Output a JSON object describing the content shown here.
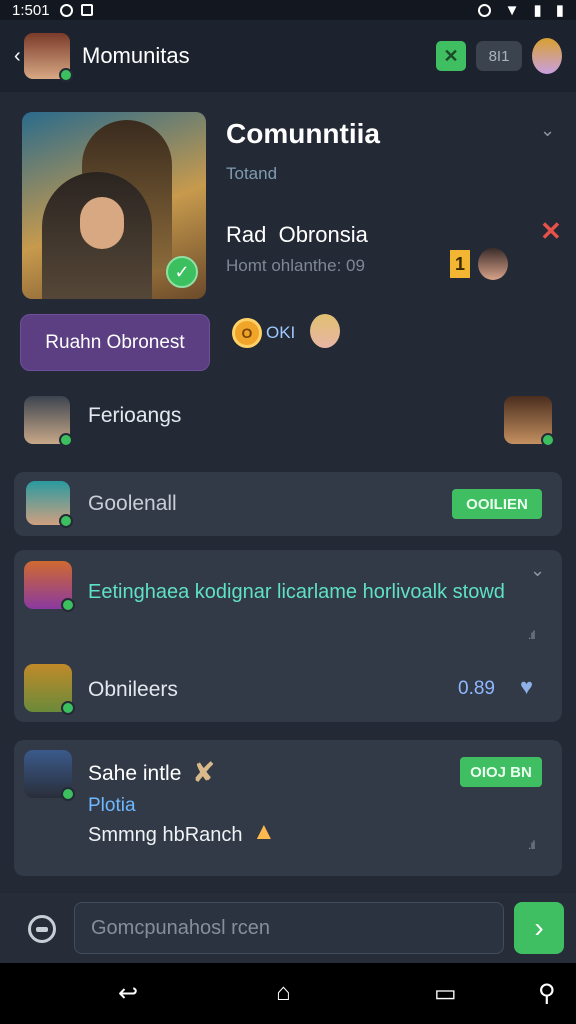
{
  "status_bar": {
    "time": "1:501"
  },
  "header": {
    "title": "Momunitas",
    "count": "8I1",
    "back_icon": "chevron-left-icon"
  },
  "featured": {
    "title": "Comunntiia",
    "subtitle": "Totand",
    "name": "Rad  Obronsia",
    "meta": "Homt ohlanthe: 09",
    "rank": "1",
    "join_label": "Ruahn Obronest",
    "coin_label": "OKI",
    "coin_symbol": "O"
  },
  "rows": {
    "feriongs": {
      "label": "Ferioangs"
    },
    "goodenall": {
      "label": "Goolenall",
      "status": "OOILIEN"
    }
  },
  "message_card": {
    "text": "Eetinghaea kodignar licarlame horlivoalk stowd",
    "sub_row": {
      "label": "Obnileers",
      "value": "0.89"
    }
  },
  "second_card": {
    "title": "Sahe intle",
    "subtitle": "Plotia",
    "body": "Smmng hbRanch",
    "status": "OIOJ BN"
  },
  "composer": {
    "placeholder": "Gomcpunahosl rcen"
  },
  "colors": {
    "accent_green": "#3fbf62",
    "accent_purple": "#5b3f82",
    "teal_text": "#5fe0c8",
    "close_red": "#e8514a"
  }
}
